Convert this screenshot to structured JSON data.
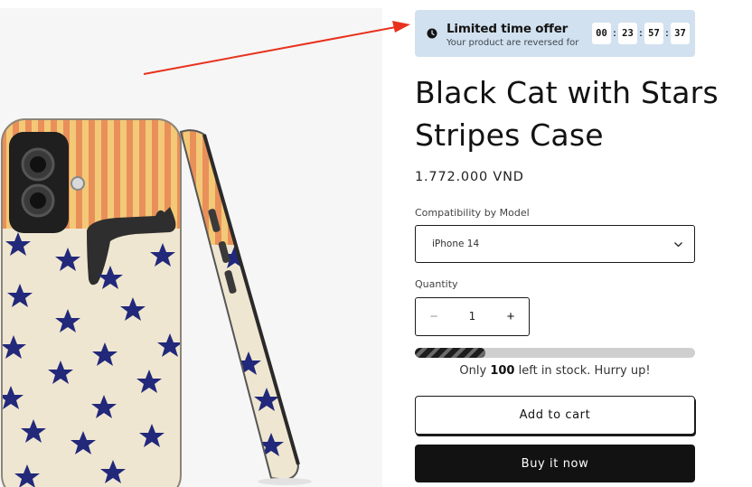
{
  "offer": {
    "title": "Limited time offer",
    "subtitle": "Your product are reversed for",
    "countdown": [
      "00",
      "23",
      "57",
      "37"
    ],
    "bg_color": "#d2e1ef"
  },
  "product": {
    "title": "Black Cat with Stars Stripes Case",
    "price": "1.772.000 VND",
    "image_icon": "phone-case-image"
  },
  "variant": {
    "label": "Compatibility by Model",
    "selected": "iPhone 14"
  },
  "quantity": {
    "label": "Quantity",
    "value": "1",
    "minus": "−",
    "plus": "+"
  },
  "stock": {
    "prefix": "Only",
    "count": "100",
    "suffix": "left in stock. Hurry up!",
    "fill_fraction": 0.25
  },
  "buttons": {
    "add_to_cart": "Add to cart",
    "buy_now": "Buy it now"
  },
  "colors": {
    "annotation_arrow": "#e8321e",
    "primary_button": "#121212"
  }
}
